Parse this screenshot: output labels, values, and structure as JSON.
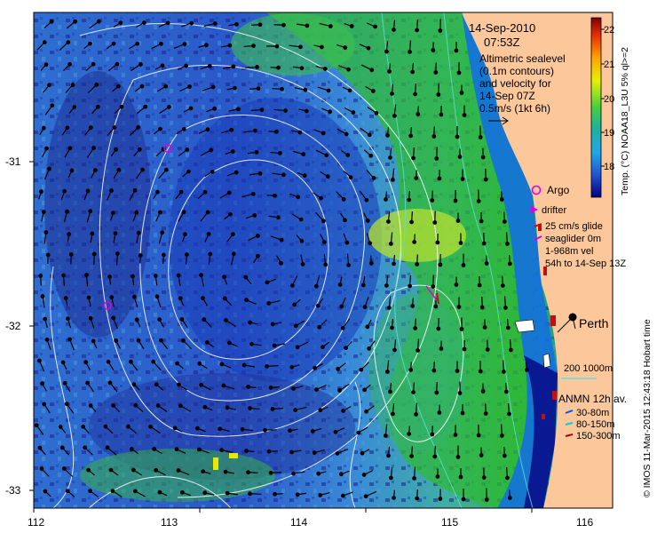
{
  "map": {
    "lon_ticks": [
      "112",
      "113",
      "114",
      "115",
      "116"
    ],
    "lat_ticks": [
      "-31",
      "-32",
      "-33"
    ],
    "credit": "© IMOS 11-Mar-2015 12:43:18 Hobart time",
    "city": "Perth"
  },
  "info": {
    "date": "14-Sep-2010",
    "time": "07:53Z",
    "desc_lines": [
      "Altimetric sealevel",
      "(0.1m contours)",
      "and velocity for",
      "14-Sep 07Z",
      "0.5m/s (1kt 6h)"
    ]
  },
  "colorbar": {
    "title": "Temp. (°C) NOAA18_L3U 5% ql>=2",
    "ticks": [
      "22",
      "21",
      "20",
      "19",
      "18"
    ]
  },
  "legend": {
    "argo": "Argo",
    "drifter": "drifter",
    "glide_speed": "25 cm/s glide",
    "seaglider": "seaglider 0m",
    "seaglider_vel": "1-968m vel",
    "seaglider_time": "54h to 14-Sep 13Z",
    "isobaths": "200  1000m",
    "anmn_title": "ANMN 12h av.",
    "anmn_items": [
      "30-80m",
      "80-150m",
      "150-300m"
    ]
  },
  "colors": {
    "land": "#fbc79b",
    "argo": "#e000e0",
    "anmn": [
      "#0050ff",
      "#00d0d0",
      "#b00000"
    ]
  }
}
